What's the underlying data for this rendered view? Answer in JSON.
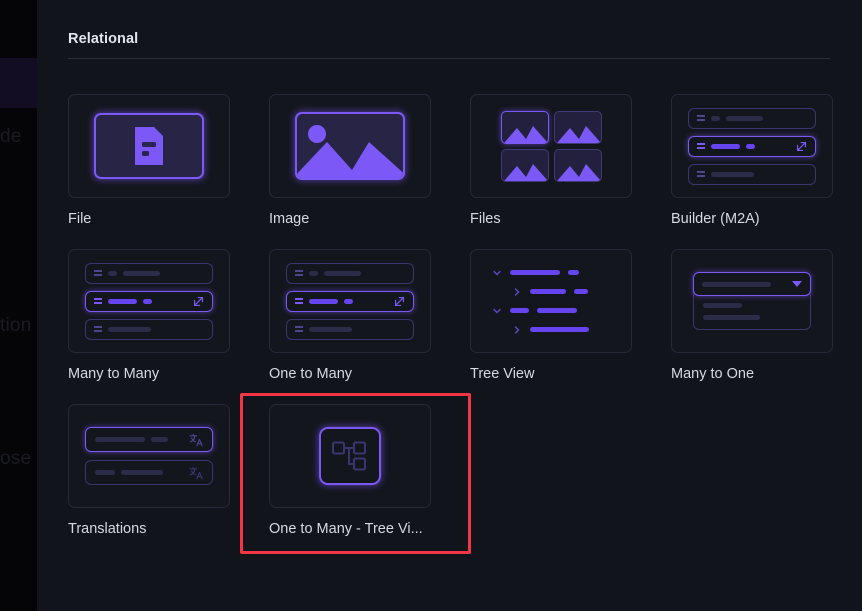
{
  "backdrop": {
    "ghost_text": [
      "de",
      "tion o",
      "ose a"
    ]
  },
  "panel": {
    "section_title": "Relational"
  },
  "colors": {
    "background": "#12141c",
    "backdrop": "#050507",
    "accent": "#7c58f7",
    "accent_fill": "#6644f0",
    "muted_fill": "#2b2c4a",
    "card_border": "#262a36",
    "annotation": "#f43545",
    "label_text": "#d5d9e2",
    "title_text": "#e2e5ec"
  },
  "interfaces": [
    {
      "id": "file",
      "label": "File",
      "icon": "file-document-icon",
      "selected": false,
      "annotated": false
    },
    {
      "id": "image",
      "label": "Image",
      "icon": "image-picture-icon",
      "selected": false,
      "annotated": false
    },
    {
      "id": "files",
      "label": "Files",
      "icon": "files-gallery-icon",
      "selected": false,
      "annotated": false
    },
    {
      "id": "builder-m2a",
      "label": "Builder (M2A)",
      "icon": "list-rows-external-link-icon",
      "selected": false,
      "annotated": false
    },
    {
      "id": "many-to-many",
      "label": "Many to Many",
      "icon": "list-rows-external-link-icon",
      "selected": false,
      "annotated": false
    },
    {
      "id": "one-to-many",
      "label": "One to Many",
      "icon": "list-rows-external-link-icon",
      "selected": false,
      "annotated": false
    },
    {
      "id": "tree-view",
      "label": "Tree View",
      "icon": "tree-hierarchy-rows-icon",
      "selected": false,
      "annotated": false
    },
    {
      "id": "many-to-one",
      "label": "Many to One",
      "icon": "dropdown-select-icon",
      "selected": false,
      "annotated": false
    },
    {
      "id": "translations",
      "label": "Translations",
      "icon": "translate-rows-icon",
      "selected": false,
      "annotated": false
    },
    {
      "id": "one-to-many-tree-view",
      "label": "One to Many - Tree Vi...",
      "icon": "node-graph-icon",
      "selected": true,
      "annotated": true
    }
  ]
}
